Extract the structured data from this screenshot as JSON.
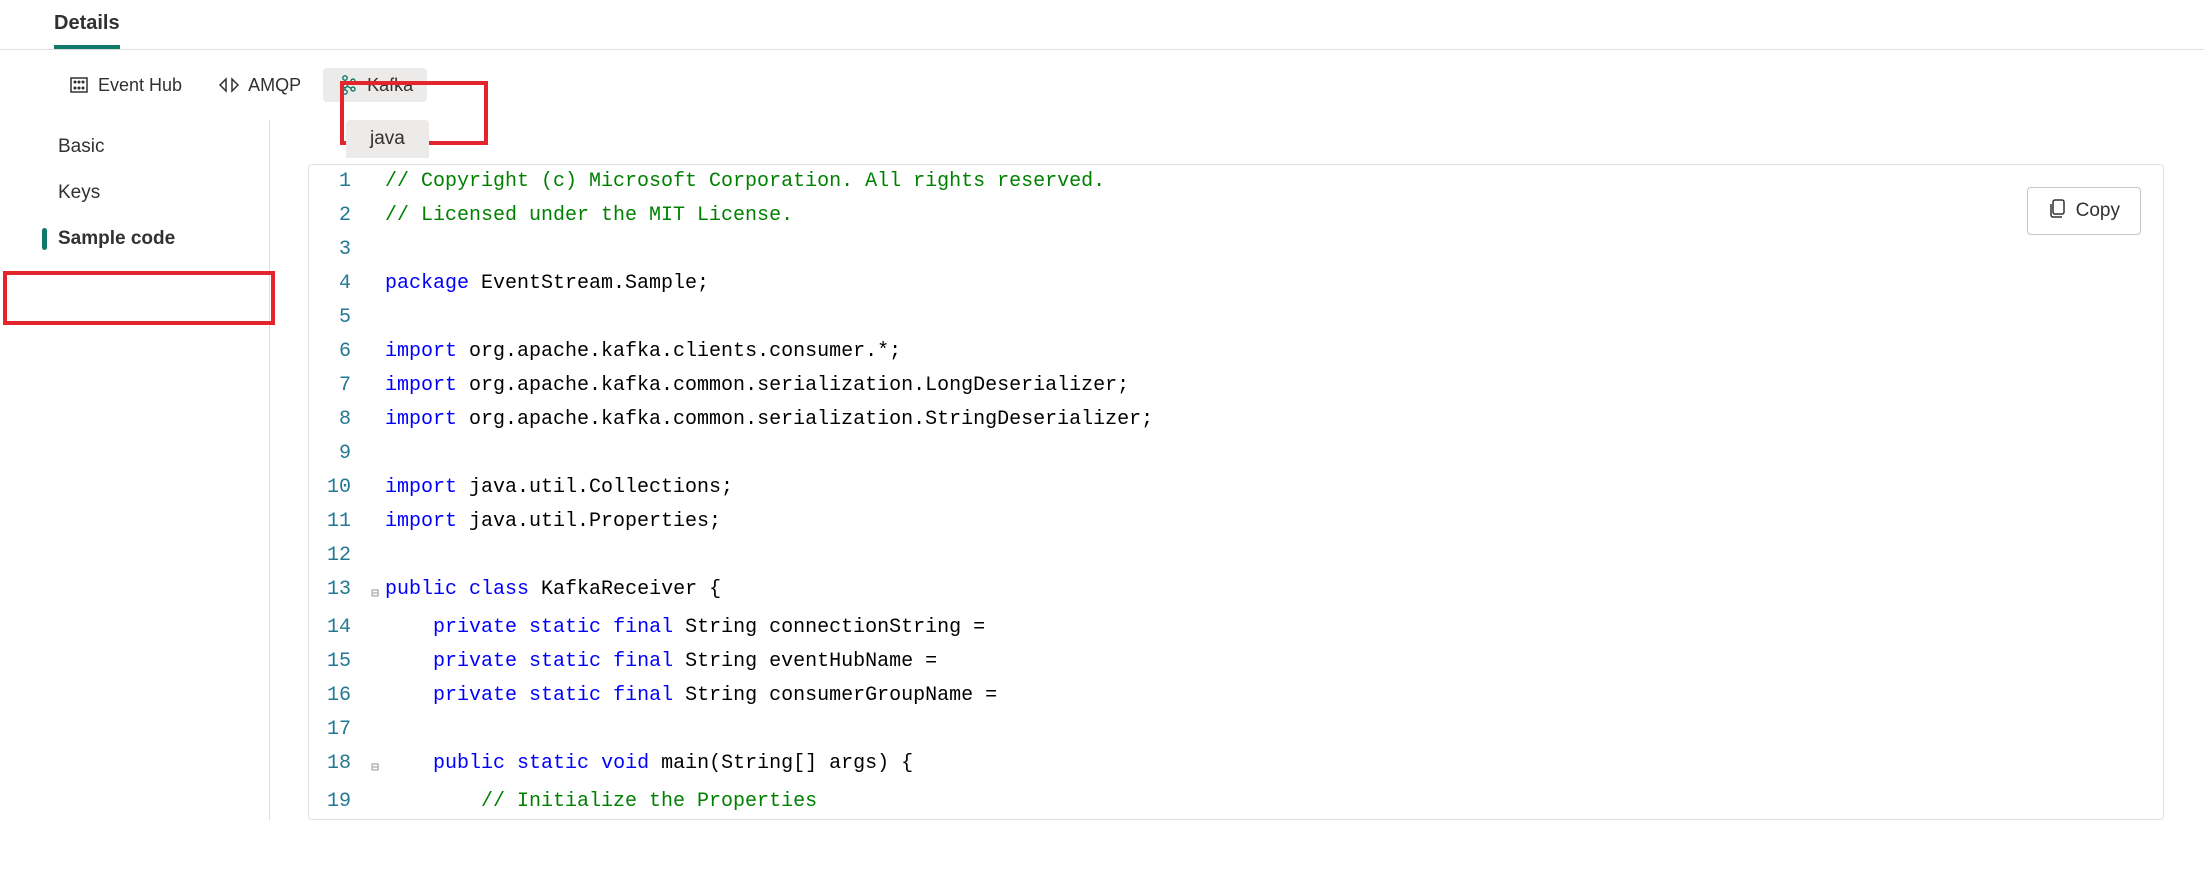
{
  "header": {
    "title": "Details"
  },
  "toolbar": {
    "tabs": [
      {
        "label": "Event Hub"
      },
      {
        "label": "AMQP"
      },
      {
        "label": "Kafka"
      }
    ]
  },
  "sidebar": {
    "items": [
      {
        "label": "Basic"
      },
      {
        "label": "Keys"
      },
      {
        "label": "Sample code"
      }
    ]
  },
  "language_chip": "java",
  "copy_label": "Copy",
  "code": {
    "lines": [
      {
        "n": 1,
        "fold": "",
        "tokens": [
          {
            "t": "// Copyright (c) Microsoft Corporation. All rights reserved.",
            "c": "comment"
          }
        ]
      },
      {
        "n": 2,
        "fold": "",
        "tokens": [
          {
            "t": "// Licensed under the MIT License.",
            "c": "comment"
          }
        ]
      },
      {
        "n": 3,
        "fold": "",
        "tokens": []
      },
      {
        "n": 4,
        "fold": "",
        "tokens": [
          {
            "t": "package",
            "c": "keyword"
          },
          {
            "t": " EventStream.Sample;",
            "c": "plain"
          }
        ]
      },
      {
        "n": 5,
        "fold": "",
        "tokens": []
      },
      {
        "n": 6,
        "fold": "",
        "tokens": [
          {
            "t": "import",
            "c": "keyword"
          },
          {
            "t": " org.apache.kafka.clients.consumer.*;",
            "c": "plain"
          }
        ]
      },
      {
        "n": 7,
        "fold": "",
        "tokens": [
          {
            "t": "import",
            "c": "keyword"
          },
          {
            "t": " org.apache.kafka.common.serialization.LongDeserializer;",
            "c": "plain"
          }
        ]
      },
      {
        "n": 8,
        "fold": "",
        "tokens": [
          {
            "t": "import",
            "c": "keyword"
          },
          {
            "t": " org.apache.kafka.common.serialization.StringDeserializer;",
            "c": "plain"
          }
        ]
      },
      {
        "n": 9,
        "fold": "",
        "tokens": []
      },
      {
        "n": 10,
        "fold": "",
        "tokens": [
          {
            "t": "import",
            "c": "keyword"
          },
          {
            "t": " java.util.Collections;",
            "c": "plain"
          }
        ]
      },
      {
        "n": 11,
        "fold": "",
        "tokens": [
          {
            "t": "import",
            "c": "keyword"
          },
          {
            "t": " java.util.Properties;",
            "c": "plain"
          }
        ]
      },
      {
        "n": 12,
        "fold": "",
        "tokens": []
      },
      {
        "n": 13,
        "fold": "⊟",
        "tokens": [
          {
            "t": "public",
            "c": "keyword"
          },
          {
            "t": " ",
            "c": "plain"
          },
          {
            "t": "class",
            "c": "keyword"
          },
          {
            "t": " KafkaReceiver {",
            "c": "plain"
          }
        ]
      },
      {
        "n": 14,
        "fold": "",
        "tokens": [
          {
            "t": "    ",
            "c": "plain"
          },
          {
            "t": "private",
            "c": "keyword"
          },
          {
            "t": " ",
            "c": "plain"
          },
          {
            "t": "static",
            "c": "keyword"
          },
          {
            "t": " ",
            "c": "plain"
          },
          {
            "t": "final",
            "c": "keyword"
          },
          {
            "t": " String connectionString =",
            "c": "plain"
          }
        ]
      },
      {
        "n": 15,
        "fold": "",
        "tokens": [
          {
            "t": "    ",
            "c": "plain"
          },
          {
            "t": "private",
            "c": "keyword"
          },
          {
            "t": " ",
            "c": "plain"
          },
          {
            "t": "static",
            "c": "keyword"
          },
          {
            "t": " ",
            "c": "plain"
          },
          {
            "t": "final",
            "c": "keyword"
          },
          {
            "t": " String eventHubName =",
            "c": "plain"
          }
        ]
      },
      {
        "n": 16,
        "fold": "",
        "tokens": [
          {
            "t": "    ",
            "c": "plain"
          },
          {
            "t": "private",
            "c": "keyword"
          },
          {
            "t": " ",
            "c": "plain"
          },
          {
            "t": "static",
            "c": "keyword"
          },
          {
            "t": " ",
            "c": "plain"
          },
          {
            "t": "final",
            "c": "keyword"
          },
          {
            "t": " String consumerGroupName =",
            "c": "plain"
          }
        ]
      },
      {
        "n": 17,
        "fold": "",
        "tokens": []
      },
      {
        "n": 18,
        "fold": "⊟",
        "tokens": [
          {
            "t": "    ",
            "c": "plain"
          },
          {
            "t": "public",
            "c": "keyword"
          },
          {
            "t": " ",
            "c": "plain"
          },
          {
            "t": "static",
            "c": "keyword"
          },
          {
            "t": " ",
            "c": "plain"
          },
          {
            "t": "void",
            "c": "keyword"
          },
          {
            "t": " main(String[] args) {",
            "c": "plain"
          }
        ]
      },
      {
        "n": 19,
        "fold": "",
        "tokens": [
          {
            "t": "        ",
            "c": "plain"
          },
          {
            "t": "// Initialize the Properties",
            "c": "comment"
          }
        ]
      }
    ]
  }
}
